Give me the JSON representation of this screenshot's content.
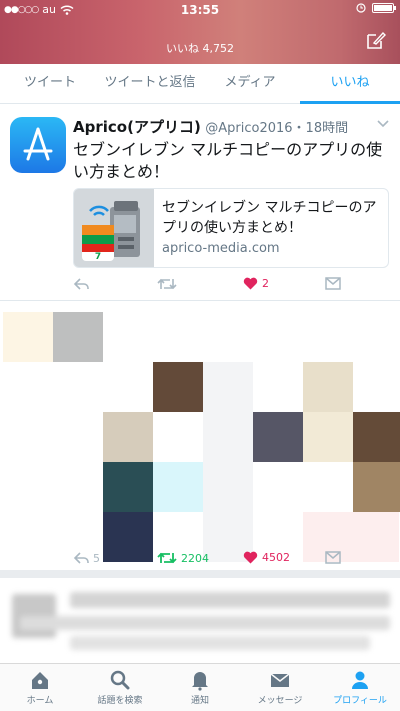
{
  "status_bar": {
    "carrier": "au",
    "time": "13:55"
  },
  "header": {
    "likes_label": "いいね 4,752"
  },
  "tabs": [
    {
      "label": "ツイート"
    },
    {
      "label": "ツイートと返信"
    },
    {
      "label": "メディア"
    },
    {
      "label": "いいね",
      "active": true
    }
  ],
  "tweet1": {
    "name": "Aprico(アプリコ)",
    "handle": "@Aprico2016",
    "time": "・18時間",
    "text": "セブンイレブン マルチコピーのアプリの使い方まとめ！",
    "card": {
      "title": "セブンイレブン マルチコピーのアプリの使い方まとめ！",
      "domain": "aprico-media.com"
    },
    "likes": "2"
  },
  "tweet2": {
    "replies": "5",
    "retweets": "2204",
    "likes": "4502"
  },
  "tabbar": [
    {
      "label": "ホーム",
      "icon": "home-icon"
    },
    {
      "label": "話題を検索",
      "icon": "search-icon"
    },
    {
      "label": "通知",
      "icon": "bell-icon"
    },
    {
      "label": "メッセージ",
      "icon": "mail-icon"
    },
    {
      "label": "プロフィール",
      "icon": "person-icon",
      "active": true
    }
  ],
  "colors": {
    "accent": "#1da1f2",
    "like": "#e0245e",
    "retweet": "#17bf63"
  }
}
